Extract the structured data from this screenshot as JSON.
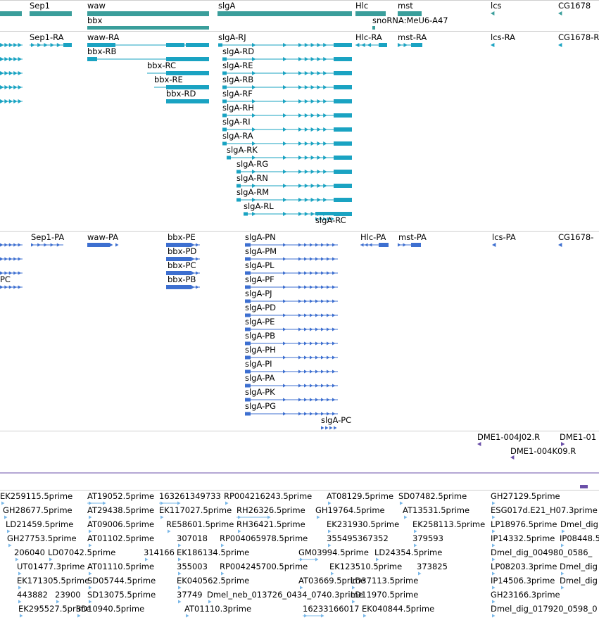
{
  "colors": {
    "gene": "#3a9e9b",
    "mrna": "#1aa3c2",
    "protein": "#3d6fd0",
    "clone": "#6a4fa8",
    "est": "#7ab8e8",
    "separator": "#cfcfcf"
  },
  "genes": {
    "items": [
      {
        "label": "Sep1"
      },
      {
        "label": "waw"
      },
      {
        "label": "bbx"
      },
      {
        "label": "slgA"
      },
      {
        "label": "Hlc"
      },
      {
        "label": "snoRNA:MeU6-A47"
      },
      {
        "label": "mst"
      },
      {
        "label": "lcs"
      },
      {
        "label": "CG1678"
      }
    ]
  },
  "transcripts": {
    "items": [
      {
        "label": "Sep1-RA"
      },
      {
        "label": "waw-RA"
      },
      {
        "label": "bbx-RB"
      },
      {
        "label": "bbx-RC"
      },
      {
        "label": "bbx-RE"
      },
      {
        "label": "bbx-RD"
      },
      {
        "label": "slgA-RJ"
      },
      {
        "label": "slgA-RD"
      },
      {
        "label": "slgA-RE"
      },
      {
        "label": "slgA-RB"
      },
      {
        "label": "slgA-RF"
      },
      {
        "label": "slgA-RH"
      },
      {
        "label": "slgA-RI"
      },
      {
        "label": "slgA-RA"
      },
      {
        "label": "slgA-RK"
      },
      {
        "label": "slgA-RG"
      },
      {
        "label": "slgA-RN"
      },
      {
        "label": "slgA-RM"
      },
      {
        "label": "slgA-RL"
      },
      {
        "label": "slgA-RC"
      },
      {
        "label": "Hlc-RA"
      },
      {
        "label": "mst-RA"
      },
      {
        "label": "lcs-RA"
      },
      {
        "label": "CG1678-R"
      }
    ]
  },
  "proteins": {
    "items": [
      {
        "label": "Sep1-PA"
      },
      {
        "label": "waw-PA"
      },
      {
        "label": "bbx-PE"
      },
      {
        "label": "bbx-PD"
      },
      {
        "label": "bbx-PC"
      },
      {
        "label": "bbx-PB"
      },
      {
        "label": "PC"
      },
      {
        "label": "slgA-PN"
      },
      {
        "label": "slgA-PM"
      },
      {
        "label": "slgA-PL"
      },
      {
        "label": "slgA-PF"
      },
      {
        "label": "slgA-PJ"
      },
      {
        "label": "slgA-PD"
      },
      {
        "label": "slgA-PE"
      },
      {
        "label": "slgA-PB"
      },
      {
        "label": "slgA-PH"
      },
      {
        "label": "slgA-PI"
      },
      {
        "label": "slgA-PA"
      },
      {
        "label": "slgA-PK"
      },
      {
        "label": "slgA-PG"
      },
      {
        "label": "slgA-PC"
      },
      {
        "label": "Hlc-PA"
      },
      {
        "label": "mst-PA"
      },
      {
        "label": "lcs-PA"
      },
      {
        "label": "CG1678-"
      }
    ]
  },
  "clones": {
    "items": [
      {
        "label": "DME1-004J02.R"
      },
      {
        "label": "DME1-01"
      },
      {
        "label": "DME1-004K09.R"
      }
    ]
  },
  "ests": {
    "items": [
      {
        "label": "EK259115.5prime"
      },
      {
        "label": "AT19052.5prime"
      },
      {
        "label": "163261349733"
      },
      {
        "label": "RP004216243.5prime"
      },
      {
        "label": "AT08129.5prime"
      },
      {
        "label": "SD07482.5prime"
      },
      {
        "label": "GH27129.5prime"
      },
      {
        "label": "GH28677.5prime"
      },
      {
        "label": "AT29438.5prime"
      },
      {
        "label": "EK117027.5prime"
      },
      {
        "label": "RH26326.5prime"
      },
      {
        "label": "GH19764.5prime"
      },
      {
        "label": "AT13531.5prime"
      },
      {
        "label": "ESG017d.E21_H07.3prime"
      },
      {
        "label": "LD21459.5prime"
      },
      {
        "label": "AT09006.5prime"
      },
      {
        "label": "RE58601.5prime"
      },
      {
        "label": "RH36421.5prime"
      },
      {
        "label": "EK231930.5prime"
      },
      {
        "label": "EK258113.5prime"
      },
      {
        "label": "LP18976.5prime"
      },
      {
        "label": "Dmel_dig"
      },
      {
        "label": "GH27753.5prime"
      },
      {
        "label": "AT01102.5prime"
      },
      {
        "label": "307018"
      },
      {
        "label": "RP004065978.5prime"
      },
      {
        "label": "355495367352"
      },
      {
        "label": "379593"
      },
      {
        "label": "IP14332.5prime"
      },
      {
        "label": "IP08448.5"
      },
      {
        "label": "206040"
      },
      {
        "label": "LD07042.5prime"
      },
      {
        "label": "314166"
      },
      {
        "label": "EK186134.5prime"
      },
      {
        "label": "GM03994.5prime"
      },
      {
        "label": "LD24354.5prime"
      },
      {
        "label": "Dmel_dig_004980_0586_"
      },
      {
        "label": "UT01477.3prime"
      },
      {
        "label": "AT01110.5prime"
      },
      {
        "label": "355003"
      },
      {
        "label": "RP004245700.5prime"
      },
      {
        "label": "EK123510.5prime"
      },
      {
        "label": "373825"
      },
      {
        "label": "LP08203.3prime"
      },
      {
        "label": "Dmel_dig"
      },
      {
        "label": "EK171305.5prime"
      },
      {
        "label": "SD05744.5prime"
      },
      {
        "label": "EK040562.5prime"
      },
      {
        "label": "AT03669.5prime"
      },
      {
        "label": "LD37113.5prime"
      },
      {
        "label": "IP14506.3prime"
      },
      {
        "label": "Dmel_dig"
      },
      {
        "label": "443882"
      },
      {
        "label": "23900"
      },
      {
        "label": "SD13075.5prime"
      },
      {
        "label": "37749"
      },
      {
        "label": "Dmel_neb_013726_0434_0740.3prime"
      },
      {
        "label": "LD11970.5prime"
      },
      {
        "label": "GH23166.3prime"
      },
      {
        "label": "EK295527.5prime"
      },
      {
        "label": "SD10940.5prime"
      },
      {
        "label": "AT01110.3prime"
      },
      {
        "label": "16233166017"
      },
      {
        "label": "EK040844.5prime"
      },
      {
        "label": "Dmel_dig_017920_0598_0"
      }
    ]
  }
}
